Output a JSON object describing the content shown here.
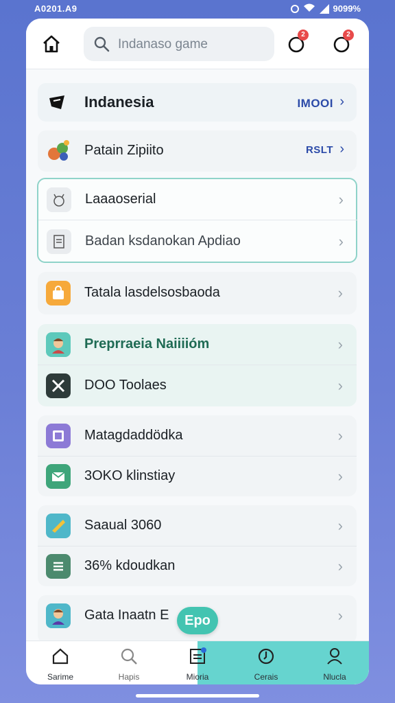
{
  "status": {
    "time": "A0201.A9",
    "battery": "9099%"
  },
  "search": {
    "placeholder": "Indanaso game"
  },
  "notifications": {
    "badge1": "2",
    "badge2": "2"
  },
  "list": {
    "item0": {
      "label": "Indanesia",
      "right": "IMOOI"
    },
    "item1": {
      "label": "Patain Zipiito",
      "right": "RSLT"
    },
    "item2": {
      "label": "Laaaoserial"
    },
    "item3": {
      "label": "Badan ksdanokan Apdiao"
    },
    "item4": {
      "label": "Tatala lasdelsosbaoda"
    },
    "item5": {
      "label": "Preprraeia Naiiiióm"
    },
    "item6": {
      "label": "DOO Toolaes"
    },
    "item7": {
      "label": "Matagdaddödka"
    },
    "item8": {
      "label": "3OKO klinstiay"
    },
    "item9": {
      "label": "Saaual 3060"
    },
    "item10": {
      "label": "36% kdoudkan"
    },
    "item11": {
      "label": "Gata Inaatn E"
    }
  },
  "fab": {
    "label": "Epo"
  },
  "nav": {
    "items": [
      {
        "label": "Sarime"
      },
      {
        "label": "Hapis"
      },
      {
        "label": "Mioria"
      },
      {
        "label": "Cerais"
      },
      {
        "label": "Nlucla"
      }
    ]
  },
  "colors": {
    "accent": "#43c4b1",
    "link": "#2b4aa8",
    "badge": "#e84a4a",
    "background": "#5a74cf"
  }
}
